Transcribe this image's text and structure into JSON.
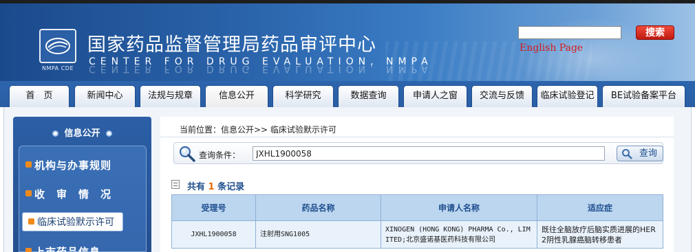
{
  "header": {
    "title_cn": "国家药品监督管理局药品审评中心",
    "title_en": "CENTER  FOR  DRUG EVALUATION,  NMPA",
    "logo_text": "NMPA CDE",
    "search": {
      "placeholder": "",
      "button_label": "搜索"
    },
    "english_link": "English Page"
  },
  "nav": {
    "items": [
      {
        "label": "首　页"
      },
      {
        "label": "新闻中心"
      },
      {
        "label": "法规与规章"
      },
      {
        "label": "信息公开"
      },
      {
        "label": "科学研究"
      },
      {
        "label": "数据查询"
      },
      {
        "label": "申请人之窗"
      },
      {
        "label": "交流与反馈"
      },
      {
        "label": "临床试验登记"
      },
      {
        "label": "BE试验备案平台"
      }
    ],
    "active_index": 3
  },
  "sidebar": {
    "title": "信息公开",
    "items": [
      {
        "label": "机构与办事规则"
      },
      {
        "label": "收　审　情　况"
      },
      {
        "label": "临床试验默示许可"
      },
      {
        "label": "上市药品信息"
      }
    ],
    "active_index": 2
  },
  "main": {
    "breadcrumb": "当前位置：信息公开>> 临床试验默示许可",
    "query": {
      "label": "查询条件：",
      "value": "JXHL1900058",
      "button_label": "查询"
    },
    "result": {
      "prefix": "共有 ",
      "count": "1",
      "suffix": " 条记录"
    },
    "table": {
      "headers": [
        "受理号",
        "药品名称",
        "申请人名称",
        "适应症"
      ],
      "rows": [
        [
          "JXHL1900058",
          "注射用SNG1005",
          "XINOGEN (HONG KONG) PHARMA Co., LIMITED;北京盛诺基医药科技有限公司",
          "既往全脑放疗后脑实质进展的HER2阴性乳腺癌脑转移患者"
        ]
      ]
    }
  },
  "colors": {
    "header_blue": "#2a63aa",
    "search_red": "#d21b1b",
    "link_blue": "#1f4f8f",
    "count_orange": "#e46a00",
    "table_header_bg": "#bcd6ef",
    "table_cell_bg": "#e9f2fb"
  }
}
